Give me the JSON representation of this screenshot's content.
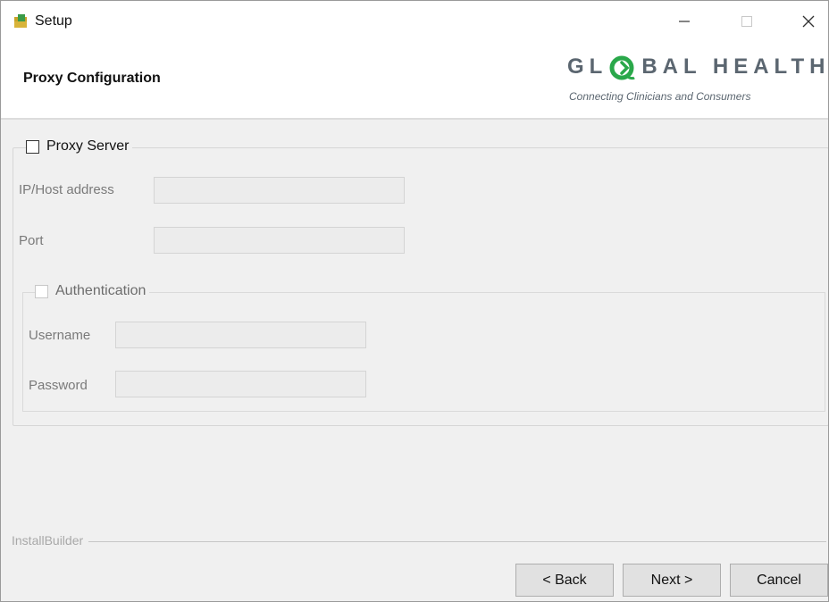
{
  "window": {
    "title": "Setup",
    "controls": {
      "minimize": "minimize",
      "maximize": "maximize",
      "close": "close"
    }
  },
  "header": {
    "page_title": "Proxy Configuration",
    "logo": {
      "word_left": "GL",
      "word_right": "BAL HEALTH",
      "tagline": "Connecting Clinicians and Consumers",
      "accent_color": "#2aa84a"
    }
  },
  "proxy": {
    "checkbox_label": "Proxy Server",
    "checked": false,
    "host_label": "IP/Host address",
    "host_value": "",
    "port_label": "Port",
    "port_value": ""
  },
  "auth": {
    "checkbox_label": "Authentication",
    "checked": false,
    "username_label": "Username",
    "username_value": "",
    "password_label": "Password",
    "password_value": ""
  },
  "footer": {
    "brand": "InstallBuilder",
    "back_label": "< Back",
    "next_label": "Next >",
    "cancel_label": "Cancel"
  }
}
